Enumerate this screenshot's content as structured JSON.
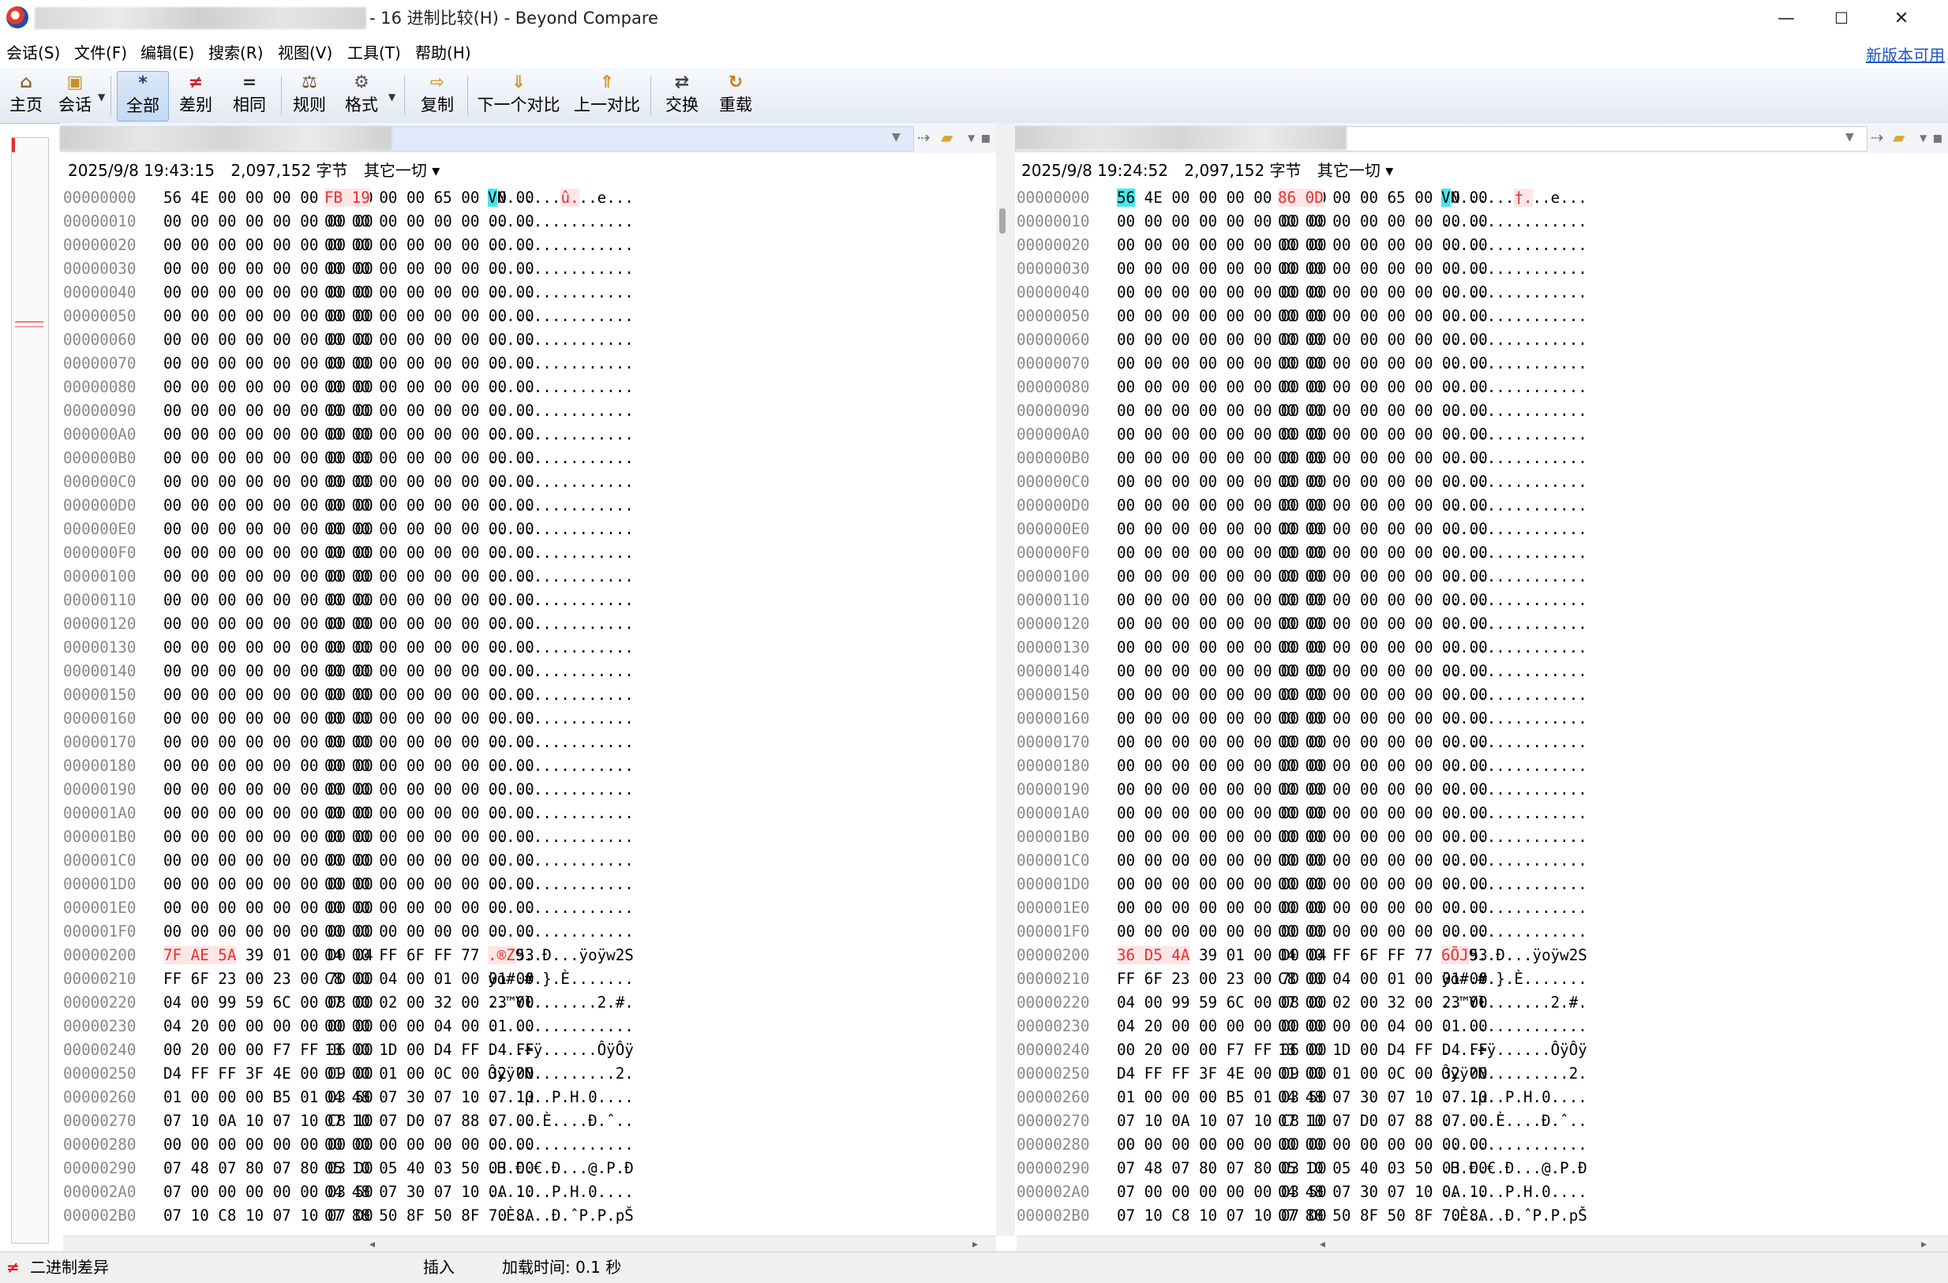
{
  "window": {
    "title": "- 16 进制比较(H) - Beyond Compare",
    "minimize": "—",
    "maximize": "☐",
    "close": "✕"
  },
  "menu": [
    "会话(S)",
    "文件(F)",
    "编辑(E)",
    "搜索(R)",
    "视图(V)",
    "工具(T)",
    "帮助(H)"
  ],
  "new_version": "新版本可用",
  "toolbar": {
    "home": "主页",
    "session": "会话",
    "all": "全部",
    "diffs": "差别",
    "same": "相同",
    "rules": "规则",
    "format": "格式",
    "copy": "复制",
    "next_diff": "下一个对比",
    "prev_diff": "上一对比",
    "swap": "交换",
    "reload": "重载",
    "icons": {
      "home": "⌂",
      "session": "▣",
      "all": "*",
      "diffs": "≠",
      "same": "=",
      "rules": "⚖",
      "format": "⚙",
      "copy": "⇨",
      "next_diff": "⇓",
      "prev_diff": "⇑",
      "swap": "⇄",
      "reload": "↻"
    }
  },
  "left": {
    "date": "2025/9/8 19:43:15",
    "size": "2,097,152 字节",
    "encoding": "其它一切 ▾"
  },
  "right": {
    "date": "2025/9/8 19:24:52",
    "size": "2,097,152 字节",
    "encoding": "其它一切 ▾"
  },
  "left_rows": [
    {
      "addr": "00000000",
      "b1": "56 4E 00 00 00 00 10 00",
      "b2": "FB 19 00 00 65 00 00 00",
      "asc": "VN......û...e..."
    },
    {
      "addr": "00000010",
      "b1": "00 00 00 00 00 00 00 00",
      "b2": "00 00 00 00 00 00 00 00",
      "asc": "................"
    },
    {
      "addr": "00000020",
      "b1": "00 00 00 00 00 00 00 00",
      "b2": "00 00 00 00 00 00 00 00",
      "asc": "................"
    },
    {
      "addr": "00000030",
      "b1": "00 00 00 00 00 00 00 00",
      "b2": "00 00 00 00 00 00 00 00",
      "asc": "................"
    },
    {
      "addr": "00000040",
      "b1": "00 00 00 00 00 00 00 00",
      "b2": "00 00 00 00 00 00 00 00",
      "asc": "................"
    },
    {
      "addr": "00000050",
      "b1": "00 00 00 00 00 00 00 00",
      "b2": "00 00 00 00 00 00 00 00",
      "asc": "................"
    },
    {
      "addr": "00000060",
      "b1": "00 00 00 00 00 00 00 00",
      "b2": "00 00 00 00 00 00 00 00",
      "asc": "................"
    },
    {
      "addr": "00000070",
      "b1": "00 00 00 00 00 00 00 00",
      "b2": "00 00 00 00 00 00 00 00",
      "asc": "................"
    },
    {
      "addr": "00000080",
      "b1": "00 00 00 00 00 00 00 00",
      "b2": "00 00 00 00 00 00 00 00",
      "asc": "................"
    },
    {
      "addr": "00000090",
      "b1": "00 00 00 00 00 00 00 00",
      "b2": "00 00 00 00 00 00 00 00",
      "asc": "................"
    },
    {
      "addr": "000000A0",
      "b1": "00 00 00 00 00 00 00 00",
      "b2": "00 00 00 00 00 00 00 00",
      "asc": "................"
    },
    {
      "addr": "000000B0",
      "b1": "00 00 00 00 00 00 00 00",
      "b2": "00 00 00 00 00 00 00 00",
      "asc": "................"
    },
    {
      "addr": "000000C0",
      "b1": "00 00 00 00 00 00 00 00",
      "b2": "00 00 00 00 00 00 00 00",
      "asc": "................"
    },
    {
      "addr": "000000D0",
      "b1": "00 00 00 00 00 00 00 00",
      "b2": "00 00 00 00 00 00 00 00",
      "asc": "................"
    },
    {
      "addr": "000000E0",
      "b1": "00 00 00 00 00 00 00 00",
      "b2": "00 00 00 00 00 00 00 00",
      "asc": "................"
    },
    {
      "addr": "000000F0",
      "b1": "00 00 00 00 00 00 00 00",
      "b2": "00 00 00 00 00 00 00 00",
      "asc": "................"
    },
    {
      "addr": "00000100",
      "b1": "00 00 00 00 00 00 00 00",
      "b2": "00 00 00 00 00 00 00 00",
      "asc": "................"
    },
    {
      "addr": "00000110",
      "b1": "00 00 00 00 00 00 00 00",
      "b2": "00 00 00 00 00 00 00 00",
      "asc": "................"
    },
    {
      "addr": "00000120",
      "b1": "00 00 00 00 00 00 00 00",
      "b2": "00 00 00 00 00 00 00 00",
      "asc": "................"
    },
    {
      "addr": "00000130",
      "b1": "00 00 00 00 00 00 00 00",
      "b2": "00 00 00 00 00 00 00 00",
      "asc": "................"
    },
    {
      "addr": "00000140",
      "b1": "00 00 00 00 00 00 00 00",
      "b2": "00 00 00 00 00 00 00 00",
      "asc": "................"
    },
    {
      "addr": "00000150",
      "b1": "00 00 00 00 00 00 00 00",
      "b2": "00 00 00 00 00 00 00 00",
      "asc": "................"
    },
    {
      "addr": "00000160",
      "b1": "00 00 00 00 00 00 00 00",
      "b2": "00 00 00 00 00 00 00 00",
      "asc": "................"
    },
    {
      "addr": "00000170",
      "b1": "00 00 00 00 00 00 00 00",
      "b2": "00 00 00 00 00 00 00 00",
      "asc": "................"
    },
    {
      "addr": "00000180",
      "b1": "00 00 00 00 00 00 00 00",
      "b2": "00 00 00 00 00 00 00 00",
      "asc": "................"
    },
    {
      "addr": "00000190",
      "b1": "00 00 00 00 00 00 00 00",
      "b2": "00 00 00 00 00 00 00 00",
      "asc": "................"
    },
    {
      "addr": "000001A0",
      "b1": "00 00 00 00 00 00 00 00",
      "b2": "00 00 00 00 00 00 00 00",
      "asc": "................"
    },
    {
      "addr": "000001B0",
      "b1": "00 00 00 00 00 00 00 00",
      "b2": "00 00 00 00 00 00 00 00",
      "asc": "................"
    },
    {
      "addr": "000001C0",
      "b1": "00 00 00 00 00 00 00 00",
      "b2": "00 00 00 00 00 00 00 00",
      "asc": "................"
    },
    {
      "addr": "000001D0",
      "b1": "00 00 00 00 00 00 00 00",
      "b2": "00 00 00 00 00 00 00 00",
      "asc": "................"
    },
    {
      "addr": "000001E0",
      "b1": "00 00 00 00 00 00 00 00",
      "b2": "00 00 00 00 00 00 00 00",
      "asc": "................"
    },
    {
      "addr": "000001F0",
      "b1": "00 00 00 00 00 00 00 00",
      "b2": "00 00 00 00 00 00 00 00",
      "asc": "................"
    },
    {
      "addr": "00000200",
      "b1": "7F AE 5A 39 01 00 D0 04",
      "b2": "04 00 FF 6F FF 77 32 53",
      "asc": ".®Z9..Ð...ÿoÿw2S"
    },
    {
      "addr": "00000210",
      "b1": "FF 6F 23 00 23 00 7D 00",
      "b2": "C8 00 04 00 01 00 01 00",
      "asc": "ÿo#.#.}.È......."
    },
    {
      "addr": "00000220",
      "b1": "04 00 99 59 6C 00 08 00",
      "b2": "07 00 02 00 32 00 23 00",
      "asc": "..™Yl.......2.#."
    },
    {
      "addr": "00000230",
      "b1": "04 20 00 00 00 00 00 00",
      "b2": "00 00 00 00 04 00 01 00",
      "asc": ". .............."
    },
    {
      "addr": "00000240",
      "b1": "00 20 00 00 F7 FF 06 00",
      "b2": "13 00 1D 00 D4 FF D4 FF",
      "asc": ". ..÷ÿ......ÔÿÔÿ"
    },
    {
      "addr": "00000250",
      "b1": "D4 FF FF 3F 4E 00 09 00",
      "b2": "01 00 01 00 0C 00 32 00",
      "asc": "Ôÿÿ?N.........2."
    },
    {
      "addr": "00000260",
      "b1": "01 00 00 00 B5 01 03 50",
      "b2": "04 48 07 30 07 10 07 10",
      "asc": "....µ..P.H.0...."
    },
    {
      "addr": "00000270",
      "b1": "07 10 0A 10 07 10 C8 10",
      "b2": "07 10 07 D0 07 88 07 00",
      "asc": "......È....Ð.ˆ.."
    },
    {
      "addr": "00000280",
      "b1": "00 00 00 00 00 00 00 00",
      "b2": "00 00 00 00 00 00 00 00",
      "asc": "................"
    },
    {
      "addr": "00000290",
      "b1": "07 48 07 80 07 80 03 D0",
      "b2": "05 10 05 40 03 50 03 D0",
      "asc": ".H.€.€.Ð...@.P.Ð"
    },
    {
      "addr": "000002A0",
      "b1": "07 00 00 00 00 00 03 50",
      "b2": "04 48 07 30 07 10 0A 10",
      "asc": ".......P.H.0...."
    },
    {
      "addr": "000002B0",
      "b1": "07 10 C8 10 07 10 07 D0",
      "b2": "07 88 50 8F 50 8F 70 8A",
      "asc": "..È....Ð.ˆP.P.pŠ"
    }
  ],
  "right_rows": [
    {
      "addr": "00000000",
      "b1": "56 4E 00 00 00 00 10 00",
      "b2": "86 0D 00 00 65 00 00 00",
      "asc": "VN......†...e..."
    },
    {
      "addr": "00000010",
      "b1": "00 00 00 00 00 00 00 00",
      "b2": "00 00 00 00 00 00 00 00",
      "asc": "................"
    },
    {
      "addr": "00000020",
      "b1": "00 00 00 00 00 00 00 00",
      "b2": "00 00 00 00 00 00 00 00",
      "asc": "................"
    },
    {
      "addr": "00000030",
      "b1": "00 00 00 00 00 00 00 00",
      "b2": "00 00 00 00 00 00 00 00",
      "asc": "................"
    },
    {
      "addr": "00000040",
      "b1": "00 00 00 00 00 00 00 00",
      "b2": "00 00 00 00 00 00 00 00",
      "asc": "................"
    },
    {
      "addr": "00000050",
      "b1": "00 00 00 00 00 00 00 00",
      "b2": "00 00 00 00 00 00 00 00",
      "asc": "................"
    },
    {
      "addr": "00000060",
      "b1": "00 00 00 00 00 00 00 00",
      "b2": "00 00 00 00 00 00 00 00",
      "asc": "................"
    },
    {
      "addr": "00000070",
      "b1": "00 00 00 00 00 00 00 00",
      "b2": "00 00 00 00 00 00 00 00",
      "asc": "................"
    },
    {
      "addr": "00000080",
      "b1": "00 00 00 00 00 00 00 00",
      "b2": "00 00 00 00 00 00 00 00",
      "asc": "................"
    },
    {
      "addr": "00000090",
      "b1": "00 00 00 00 00 00 00 00",
      "b2": "00 00 00 00 00 00 00 00",
      "asc": "................"
    },
    {
      "addr": "000000A0",
      "b1": "00 00 00 00 00 00 00 00",
      "b2": "00 00 00 00 00 00 00 00",
      "asc": "................"
    },
    {
      "addr": "000000B0",
      "b1": "00 00 00 00 00 00 00 00",
      "b2": "00 00 00 00 00 00 00 00",
      "asc": "................"
    },
    {
      "addr": "000000C0",
      "b1": "00 00 00 00 00 00 00 00",
      "b2": "00 00 00 00 00 00 00 00",
      "asc": "................"
    },
    {
      "addr": "000000D0",
      "b1": "00 00 00 00 00 00 00 00",
      "b2": "00 00 00 00 00 00 00 00",
      "asc": "................"
    },
    {
      "addr": "000000E0",
      "b1": "00 00 00 00 00 00 00 00",
      "b2": "00 00 00 00 00 00 00 00",
      "asc": "................"
    },
    {
      "addr": "000000F0",
      "b1": "00 00 00 00 00 00 00 00",
      "b2": "00 00 00 00 00 00 00 00",
      "asc": "................"
    },
    {
      "addr": "00000100",
      "b1": "00 00 00 00 00 00 00 00",
      "b2": "00 00 00 00 00 00 00 00",
      "asc": "................"
    },
    {
      "addr": "00000110",
      "b1": "00 00 00 00 00 00 00 00",
      "b2": "00 00 00 00 00 00 00 00",
      "asc": "................"
    },
    {
      "addr": "00000120",
      "b1": "00 00 00 00 00 00 00 00",
      "b2": "00 00 00 00 00 00 00 00",
      "asc": "................"
    },
    {
      "addr": "00000130",
      "b1": "00 00 00 00 00 00 00 00",
      "b2": "00 00 00 00 00 00 00 00",
      "asc": "................"
    },
    {
      "addr": "00000140",
      "b1": "00 00 00 00 00 00 00 00",
      "b2": "00 00 00 00 00 00 00 00",
      "asc": "................"
    },
    {
      "addr": "00000150",
      "b1": "00 00 00 00 00 00 00 00",
      "b2": "00 00 00 00 00 00 00 00",
      "asc": "................"
    },
    {
      "addr": "00000160",
      "b1": "00 00 00 00 00 00 00 00",
      "b2": "00 00 00 00 00 00 00 00",
      "asc": "................"
    },
    {
      "addr": "00000170",
      "b1": "00 00 00 00 00 00 00 00",
      "b2": "00 00 00 00 00 00 00 00",
      "asc": "................"
    },
    {
      "addr": "00000180",
      "b1": "00 00 00 00 00 00 00 00",
      "b2": "00 00 00 00 00 00 00 00",
      "asc": "................"
    },
    {
      "addr": "00000190",
      "b1": "00 00 00 00 00 00 00 00",
      "b2": "00 00 00 00 00 00 00 00",
      "asc": "................"
    },
    {
      "addr": "000001A0",
      "b1": "00 00 00 00 00 00 00 00",
      "b2": "00 00 00 00 00 00 00 00",
      "asc": "................"
    },
    {
      "addr": "000001B0",
      "b1": "00 00 00 00 00 00 00 00",
      "b2": "00 00 00 00 00 00 00 00",
      "asc": "................"
    },
    {
      "addr": "000001C0",
      "b1": "00 00 00 00 00 00 00 00",
      "b2": "00 00 00 00 00 00 00 00",
      "asc": "................"
    },
    {
      "addr": "000001D0",
      "b1": "00 00 00 00 00 00 00 00",
      "b2": "00 00 00 00 00 00 00 00",
      "asc": "................"
    },
    {
      "addr": "000001E0",
      "b1": "00 00 00 00 00 00 00 00",
      "b2": "00 00 00 00 00 00 00 00",
      "asc": "................"
    },
    {
      "addr": "000001F0",
      "b1": "00 00 00 00 00 00 00 00",
      "b2": "00 00 00 00 00 00 00 00",
      "asc": "................"
    },
    {
      "addr": "00000200",
      "b1": "36 D5 4A 39 01 00 D0 04",
      "b2": "04 00 FF 6F FF 77 32 53",
      "asc": "6ÕJ9..Ð...ÿoÿw2S"
    },
    {
      "addr": "00000210",
      "b1": "FF 6F 23 00 23 00 7D 00",
      "b2": "C8 00 04 00 01 00 01 00",
      "asc": "ÿo#.#.}.È......."
    },
    {
      "addr": "00000220",
      "b1": "04 00 99 59 6C 00 08 00",
      "b2": "07 00 02 00 32 00 23 00",
      "asc": "..™Yl.......2.#."
    },
    {
      "addr": "00000230",
      "b1": "04 20 00 00 00 00 00 00",
      "b2": "00 00 00 00 04 00 01 00",
      "asc": ". .............."
    },
    {
      "addr": "00000240",
      "b1": "00 20 00 00 F7 FF 06 00",
      "b2": "13 00 1D 00 D4 FF D4 FF",
      "asc": ". ..÷ÿ......ÔÿÔÿ"
    },
    {
      "addr": "00000250",
      "b1": "D4 FF FF 3F 4E 00 09 00",
      "b2": "01 00 01 00 0C 00 32 00",
      "asc": "Ôÿÿ?N.........2."
    },
    {
      "addr": "00000260",
      "b1": "01 00 00 00 B5 01 03 50",
      "b2": "04 48 07 30 07 10 07 10",
      "asc": "....µ..P.H.0...."
    },
    {
      "addr": "00000270",
      "b1": "07 10 0A 10 07 10 C8 10",
      "b2": "07 10 07 D0 07 88 07 00",
      "asc": "......È....Ð.ˆ.."
    },
    {
      "addr": "00000280",
      "b1": "00 00 00 00 00 00 00 00",
      "b2": "00 00 00 00 00 00 00 00",
      "asc": "................"
    },
    {
      "addr": "00000290",
      "b1": "07 48 07 80 07 80 03 D0",
      "b2": "05 10 05 40 03 50 03 D0",
      "asc": ".H.€.€.Ð...@.P.Ð"
    },
    {
      "addr": "000002A0",
      "b1": "07 00 00 00 00 00 03 50",
      "b2": "04 48 07 30 07 10 0A 10",
      "asc": ".......P.H.0...."
    },
    {
      "addr": "000002B0",
      "b1": "07 10 C8 10 07 10 07 D0",
      "b2": "07 88 50 8F 50 8F 70 8A",
      "asc": "..È....Ð.ˆP.P.pŠ"
    }
  ],
  "status": {
    "icon": "≠",
    "mode": "二进制差异",
    "insert": "插入",
    "load_time": "加载时间:  0.1 秒"
  },
  "colors": {
    "diff_text": "#e53030",
    "diff_bg": "#fde6e6",
    "cursor": "#44e6ee",
    "link": "#1a56c8"
  }
}
